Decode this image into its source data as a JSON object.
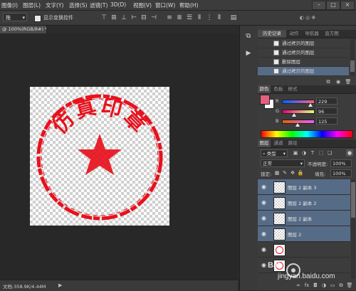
{
  "menubar": {
    "items": [
      "图像(I)",
      "图层(L)",
      "文字(Y)",
      "选择(S)",
      "滤镜(T)",
      "3D(D)",
      "视图(V)",
      "窗口(W)",
      "帮助(H)"
    ],
    "window_controls": [
      "–",
      "□",
      "×"
    ]
  },
  "options_bar": {
    "mode_value": "拖",
    "show_transform_label": "显示变换控件"
  },
  "document": {
    "tab_label": "@ 100%(RGB/8#) * ×"
  },
  "canvas": {
    "stamp_text": "仿真印章",
    "stamp_color": "#e8111d"
  },
  "status": {
    "doc_info": "文档:358.9K/4.44M",
    "arrow": "▶"
  },
  "history_panel": {
    "tabs": [
      "历史记录",
      "动作",
      "导航器",
      "直方图"
    ],
    "items": [
      "通过拷贝的图层",
      "通过拷贝的图层",
      "删除图层",
      "通过拷贝的图层"
    ]
  },
  "color_panel": {
    "tabs": [
      "颜色",
      "色板",
      "样式"
    ],
    "foreground": "#e5607d",
    "channels": [
      {
        "label": "R",
        "value": "229",
        "fraction": 0.898
      },
      {
        "label": "G",
        "value": "96",
        "fraction": 0.376
      },
      {
        "label": "B",
        "value": "125",
        "fraction": 0.49
      }
    ]
  },
  "layers_panel": {
    "tabs": [
      "图层",
      "通道",
      "路径"
    ],
    "filter_label": "类型",
    "blend_mode": "正常",
    "opacity_label": "不透明度:",
    "opacity_value": "100%",
    "lock_label": "锁定:",
    "fill_label": "填充:",
    "fill_value": "100%",
    "layers": [
      {
        "name": "图层 2 副本 3",
        "selected": true
      },
      {
        "name": "图层 2 副本 2",
        "selected": true
      },
      {
        "name": "图层 2 副本",
        "selected": true
      },
      {
        "name": "图层 2",
        "selected": true
      },
      {
        "name": "",
        "selected": false
      },
      {
        "name": "",
        "selected": false
      }
    ]
  },
  "watermark": {
    "line1": "Bai",
    "line2": "jingyan.baidu.com"
  }
}
